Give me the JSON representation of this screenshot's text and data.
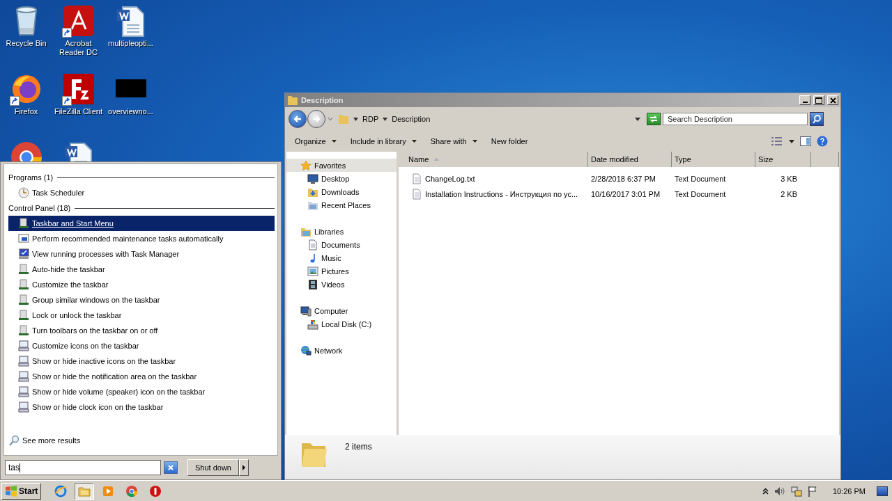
{
  "desktop_icons": [
    {
      "kind": "recycle",
      "label": "Recycle Bin",
      "shortcut": false
    },
    {
      "kind": "pdf",
      "label": "Acrobat Reader DC",
      "shortcut": true
    },
    {
      "kind": "word",
      "label": "multipleopti...",
      "shortcut": false
    },
    {
      "kind": "firefox",
      "label": "Firefox",
      "shortcut": true
    },
    {
      "kind": "filezilla",
      "label": "FileZilla Client",
      "shortcut": true
    },
    {
      "kind": "redacted",
      "label": "overviewno...",
      "shortcut": false
    },
    {
      "kind": "chrome"
    },
    {
      "kind": "word"
    }
  ],
  "start_menu": {
    "groups": [
      {
        "title": "Programs (1)",
        "items": [
          {
            "kind": "clock",
            "label": "Task Scheduler",
            "selected": false
          }
        ]
      },
      {
        "title": "Control Panel (18)",
        "items": [
          {
            "kind": "taskbar",
            "label": "Taskbar and Start Menu",
            "selected": true
          },
          {
            "kind": "maintenance",
            "label": "Perform recommended maintenance tasks automatically",
            "selected": false
          },
          {
            "kind": "taskmgr",
            "label": "View running processes with Task Manager",
            "selected": false
          },
          {
            "kind": "taskbar",
            "label": "Auto-hide the taskbar",
            "selected": false
          },
          {
            "kind": "taskbar",
            "label": "Customize the taskbar",
            "selected": false
          },
          {
            "kind": "taskbar",
            "label": "Group similar windows on the taskbar",
            "selected": false
          },
          {
            "kind": "taskbar",
            "label": "Lock or unlock the taskbar",
            "selected": false
          },
          {
            "kind": "taskbar",
            "label": "Turn toolbars on the taskbar on or off",
            "selected": false
          },
          {
            "kind": "notify",
            "label": "Customize icons on the taskbar",
            "selected": false
          },
          {
            "kind": "notify",
            "label": "Show or hide inactive icons on the taskbar",
            "selected": false
          },
          {
            "kind": "notify",
            "label": "Show or hide the notification area on the taskbar",
            "selected": false
          },
          {
            "kind": "notify",
            "label": "Show or hide volume (speaker) icon on the taskbar",
            "selected": false
          },
          {
            "kind": "notify",
            "label": "Show or hide clock icon on the taskbar",
            "selected": false
          }
        ]
      }
    ],
    "see_more": "See more results",
    "search": {
      "value": "tas"
    },
    "shutdown": "Shut down"
  },
  "explorer": {
    "title": "Description",
    "breadcrumb": [
      "RDP",
      "Description"
    ],
    "search": {
      "placeholder": "Search Description"
    },
    "toolbar": [
      {
        "label": "Organize",
        "dropdown": true
      },
      {
        "label": "Include in library",
        "dropdown": true
      },
      {
        "label": "Share with",
        "dropdown": true
      },
      {
        "label": "New folder",
        "dropdown": false
      }
    ],
    "nav": [
      {
        "kind": "star",
        "label": "Favorites",
        "selected": true,
        "children": [
          {
            "kind": "desktop",
            "label": "Desktop",
            "selected": false
          },
          {
            "kind": "downloads",
            "label": "Downloads",
            "selected": false
          },
          {
            "kind": "recent",
            "label": "Recent Places",
            "selected": false
          }
        ]
      },
      {
        "kind": "library",
        "label": "Libraries",
        "selected": false,
        "children": [
          {
            "kind": "document",
            "label": "Documents",
            "selected": false
          },
          {
            "kind": "music",
            "label": "Music",
            "selected": false
          },
          {
            "kind": "pictures",
            "label": "Pictures",
            "selected": false
          },
          {
            "kind": "videos",
            "label": "Videos",
            "selected": false
          }
        ]
      },
      {
        "kind": "computer",
        "label": "Computer",
        "selected": false,
        "children": [
          {
            "kind": "disk",
            "label": "Local Disk (C:)",
            "selected": false
          }
        ]
      },
      {
        "kind": "network",
        "label": "Network",
        "selected": false
      }
    ],
    "columns": [
      "Name",
      "Date modified",
      "Type",
      "Size"
    ],
    "rows": [
      {
        "name": "ChangeLog.txt",
        "date": "2/28/2018 6:37 PM",
        "type": "Text Document",
        "size": "3 KB"
      },
      {
        "name": "Installation Instructions - Инструкция по ус...",
        "date": "10/16/2017 3:01 PM",
        "type": "Text Document",
        "size": "2 KB"
      }
    ],
    "status": "2 items"
  },
  "taskbar": {
    "start": "Start",
    "apps": [
      {
        "kind": "ie",
        "selected": false
      },
      {
        "kind": "folder",
        "selected": true
      },
      {
        "kind": "media",
        "selected": false
      },
      {
        "kind": "chrome",
        "selected": false
      },
      {
        "kind": "stop",
        "selected": false
      }
    ],
    "clock": "10:26 PM"
  }
}
